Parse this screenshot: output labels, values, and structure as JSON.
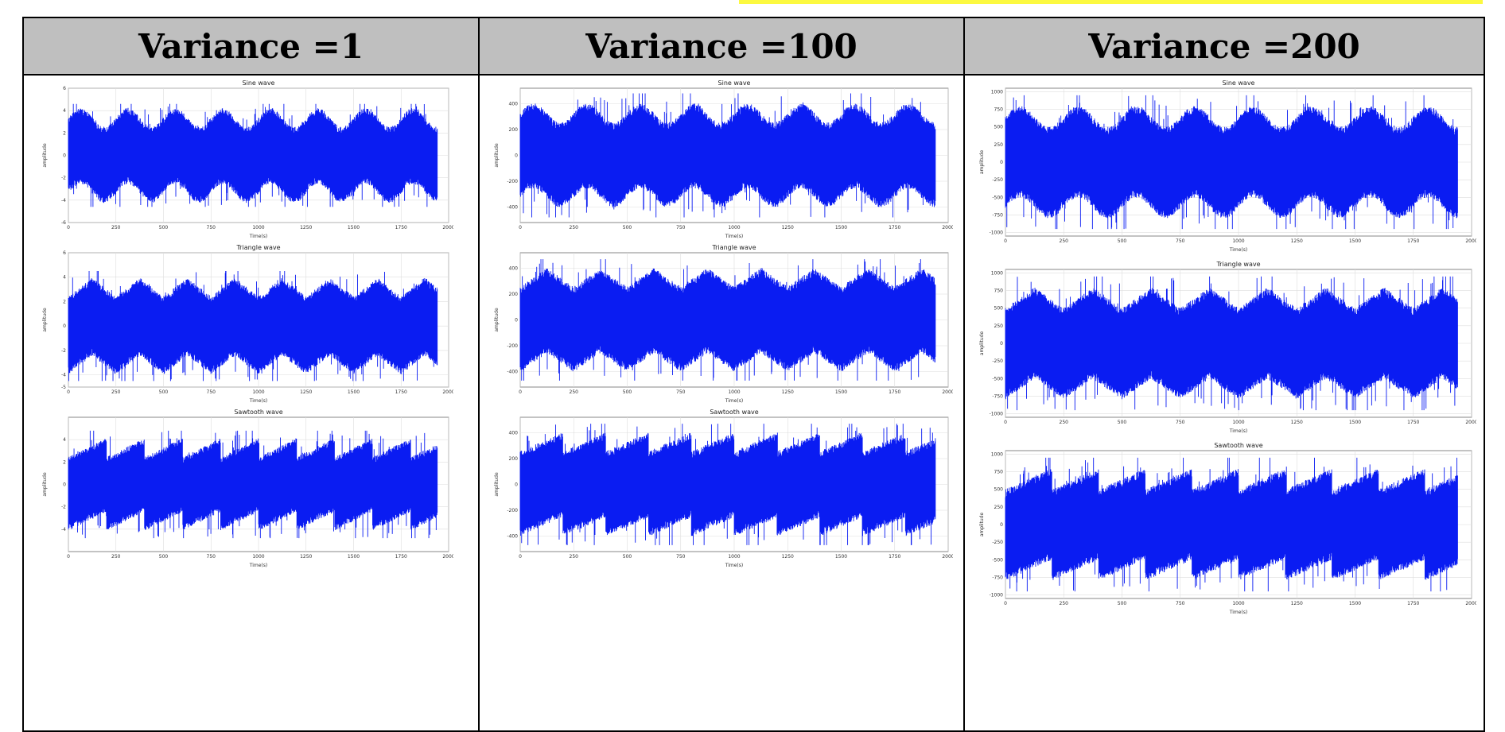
{
  "colors": {
    "header_bg": "#bfbfbf",
    "signal": "#0a1cf2",
    "highlight": "#fcf940",
    "grid": "#dddddd"
  },
  "columns": [
    {
      "label": "Variance =1"
    },
    {
      "label": "Variance =100"
    },
    {
      "label": "Variance =200"
    }
  ],
  "chart_data": [
    {
      "type": "line",
      "panel": "variance-1-sine",
      "title": "Sine wave",
      "xlabel": "Time(s)",
      "ylabel": "amplitude",
      "xlim": [
        0,
        2000
      ],
      "ylim": [
        -6,
        6
      ],
      "xticks": [
        "0",
        "250",
        "500",
        "750",
        "1000",
        "1250",
        "1500",
        "1750",
        "2000"
      ],
      "yticks": [
        "-6",
        "-4",
        "-2",
        "0",
        "2",
        "4",
        "6"
      ],
      "series": [
        {
          "waveform": "sine",
          "cycles": 8,
          "amplitude": 1,
          "noise_band": [
            -3.4,
            3.4
          ],
          "peak_envelope": [
            4.6,
            -4.6
          ]
        }
      ],
      "grid": true
    },
    {
      "type": "line",
      "panel": "variance-1-triangle",
      "title": "Triangle wave",
      "xlabel": "Time(s)",
      "ylabel": "amplitude",
      "xlim": [
        0,
        2000
      ],
      "ylim": [
        -5,
        6
      ],
      "xticks": [
        "0",
        "250",
        "500",
        "750",
        "1000",
        "1250",
        "1500",
        "1750",
        "2000"
      ],
      "yticks": [
        "-5",
        "-4",
        "-2",
        "0",
        "2",
        "4",
        "6"
      ],
      "series": [
        {
          "waveform": "triangle",
          "cycles": 8,
          "amplitude": 1,
          "noise_band": [
            -3.2,
            3.2
          ],
          "peak_envelope": [
            4.5,
            -4.5
          ]
        }
      ],
      "grid": true
    },
    {
      "type": "line",
      "panel": "variance-1-sawtooth",
      "title": "Sawtooth wave",
      "xlabel": "Time(s)",
      "ylabel": "amplitude",
      "xlim": [
        0,
        2000
      ],
      "ylim": [
        -6,
        6
      ],
      "xticks": [
        "0",
        "250",
        "500",
        "750",
        "1000",
        "1250",
        "1500",
        "1750",
        "2000"
      ],
      "yticks": [
        "-4",
        "-2",
        "0",
        "2",
        "4"
      ],
      "series": [
        {
          "waveform": "sawtooth",
          "cycles": 10,
          "amplitude": 1,
          "noise_band": [
            -3.3,
            3.3
          ],
          "peak_envelope": [
            4.8,
            -4.8
          ]
        }
      ],
      "grid": true
    },
    {
      "type": "line",
      "panel": "variance-100-sine",
      "title": "Sine wave",
      "xlabel": "Time(s)",
      "ylabel": "amplitude",
      "xlim": [
        0,
        2000
      ],
      "ylim": [
        -520,
        520
      ],
      "xticks": [
        "0",
        "250",
        "500",
        "750",
        "1000",
        "1250",
        "1500",
        "1750",
        "2000"
      ],
      "yticks": [
        "-400",
        "-200",
        "0",
        "200",
        "400"
      ],
      "series": [
        {
          "waveform": "sine",
          "cycles": 8,
          "amplitude": 1,
          "noise_band": [
            -330,
            330
          ],
          "peak_envelope": [
            480,
            -480
          ]
        }
      ],
      "grid": true
    },
    {
      "type": "line",
      "panel": "variance-100-triangle",
      "title": "Triangle wave",
      "xlabel": "Time(s)",
      "ylabel": "amplitude",
      "xlim": [
        0,
        2000
      ],
      "ylim": [
        -520,
        520
      ],
      "xticks": [
        "0",
        "250",
        "500",
        "750",
        "1000",
        "1250",
        "1500",
        "1750",
        "2000"
      ],
      "yticks": [
        "-400",
        "-200",
        "0",
        "200",
        "400"
      ],
      "series": [
        {
          "waveform": "triangle",
          "cycles": 8,
          "amplitude": 1,
          "noise_band": [
            -330,
            330
          ],
          "peak_envelope": [
            470,
            -470
          ]
        }
      ],
      "grid": true
    },
    {
      "type": "line",
      "panel": "variance-100-sawtooth",
      "title": "Sawtooth wave",
      "xlabel": "Time(s)",
      "ylabel": "amplitude",
      "xlim": [
        0,
        2000
      ],
      "ylim": [
        -520,
        520
      ],
      "xticks": [
        "0",
        "250",
        "500",
        "750",
        "1000",
        "1250",
        "1500",
        "1750",
        "2000"
      ],
      "yticks": [
        "-400",
        "-200",
        "0",
        "200",
        "400"
      ],
      "series": [
        {
          "waveform": "sawtooth",
          "cycles": 10,
          "amplitude": 1,
          "noise_band": [
            -330,
            330
          ],
          "peak_envelope": [
            470,
            -470
          ]
        }
      ],
      "grid": true
    },
    {
      "type": "line",
      "panel": "variance-200-sine",
      "title": "Sine wave",
      "xlabel": "Time(s)",
      "ylabel": "amplitude",
      "xlim": [
        0,
        2000
      ],
      "ylim": [
        -1050,
        1050
      ],
      "xticks": [
        "0",
        "250",
        "500",
        "750",
        "1000",
        "1250",
        "1500",
        "1750",
        "2000"
      ],
      "yticks": [
        "-1000",
        "-750",
        "-500",
        "-250",
        "0",
        "250",
        "500",
        "750",
        "1000"
      ],
      "series": [
        {
          "waveform": "sine",
          "cycles": 8,
          "amplitude": 1,
          "noise_band": [
            -650,
            650
          ],
          "peak_envelope": [
            950,
            -950
          ]
        }
      ],
      "grid": true
    },
    {
      "type": "line",
      "panel": "variance-200-triangle",
      "title": "Triangle wave",
      "xlabel": "Time(s)",
      "ylabel": "amplitude",
      "xlim": [
        0,
        2000
      ],
      "ylim": [
        -1050,
        1050
      ],
      "xticks": [
        "0",
        "250",
        "500",
        "750",
        "1000",
        "1250",
        "1500",
        "1750",
        "2000"
      ],
      "yticks": [
        "-1000",
        "-750",
        "-500",
        "-250",
        "0",
        "250",
        "500",
        "750",
        "1000"
      ],
      "series": [
        {
          "waveform": "triangle",
          "cycles": 8,
          "amplitude": 1,
          "noise_band": [
            -650,
            650
          ],
          "peak_envelope": [
            950,
            -950
          ]
        }
      ],
      "grid": true
    },
    {
      "type": "line",
      "panel": "variance-200-sawtooth",
      "title": "Sawtooth wave",
      "xlabel": "Time(s)",
      "ylabel": "amplitude",
      "xlim": [
        0,
        2000
      ],
      "ylim": [
        -1050,
        1050
      ],
      "xticks": [
        "0",
        "250",
        "500",
        "750",
        "1000",
        "1250",
        "1500",
        "1750",
        "2000"
      ],
      "yticks": [
        "-1000",
        "-750",
        "-500",
        "-250",
        "0",
        "250",
        "500",
        "750",
        "1000"
      ],
      "series": [
        {
          "waveform": "sawtooth",
          "cycles": 10,
          "amplitude": 1,
          "noise_band": [
            -650,
            650
          ],
          "peak_envelope": [
            950,
            -950
          ]
        }
      ],
      "grid": true
    }
  ]
}
